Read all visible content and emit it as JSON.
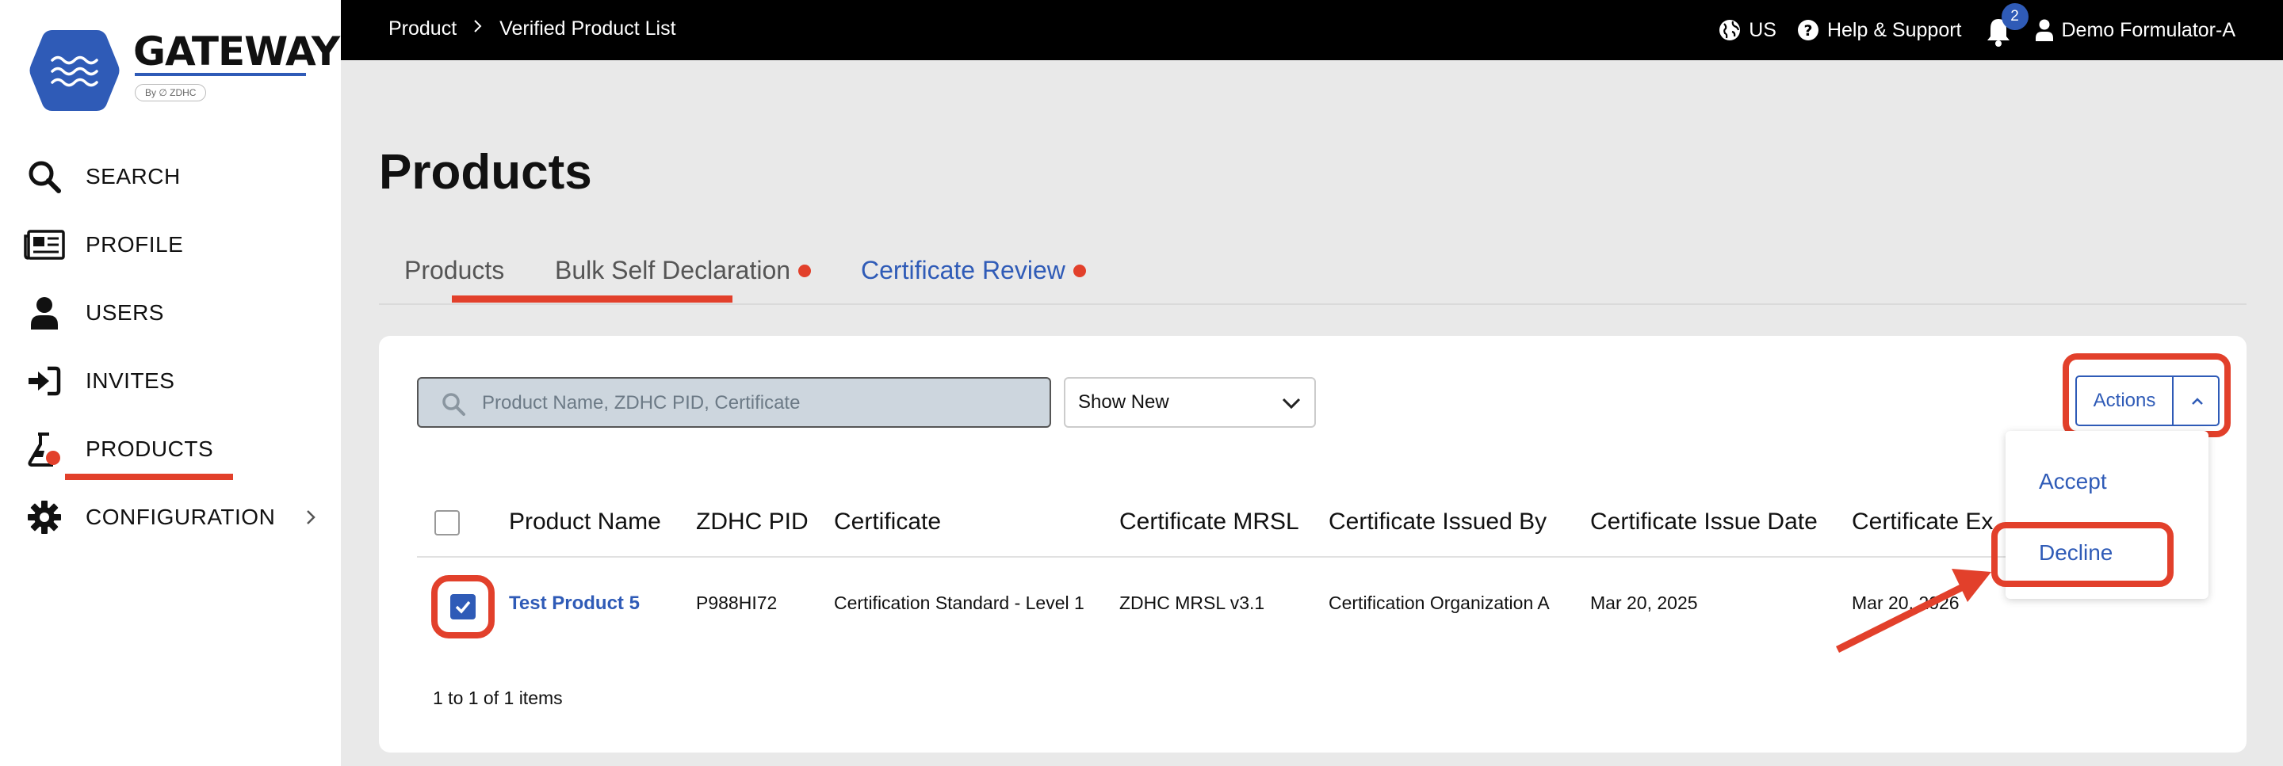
{
  "sidebar": {
    "logo": {
      "title": "GATEWAY",
      "by": "By ∅ ZDHC"
    },
    "items": [
      {
        "label": "SEARCH",
        "icon": "search-icon"
      },
      {
        "label": "PROFILE",
        "icon": "profile-card-icon"
      },
      {
        "label": "USERS",
        "icon": "user-icon"
      },
      {
        "label": "INVITES",
        "icon": "sign-in-icon"
      },
      {
        "label": "PRODUCTS",
        "icon": "flask-icon",
        "active": true
      },
      {
        "label": "CONFIGURATION",
        "icon": "gear-icon"
      }
    ]
  },
  "topbar": {
    "breadcrumb": [
      "Product",
      "Verified Product List"
    ],
    "region": "US",
    "help": "Help & Support",
    "notifications": "2",
    "user": "Demo Formulator-A"
  },
  "page": {
    "title": "Products",
    "tabs": [
      {
        "label": "Products",
        "dot": false
      },
      {
        "label": "Bulk Self Declaration",
        "dot": true
      },
      {
        "label": "Certificate Review",
        "dot": true,
        "active": true
      }
    ]
  },
  "filters": {
    "search_placeholder": "Product Name, ZDHC PID, Certificate",
    "show_value": "Show New"
  },
  "actions": {
    "label": "Actions",
    "menu": [
      "Accept",
      "Decline"
    ]
  },
  "table": {
    "columns": [
      "Product Name",
      "ZDHC PID",
      "Certificate",
      "Certificate MRSL",
      "Certificate Issued By",
      "Certificate Issue Date",
      "Certificate Ex"
    ],
    "rows": [
      {
        "product_name": "Test Product 5",
        "zdhc_pid": "P988HI72",
        "certificate": "Certification Standard - Level 1",
        "certificate_mrsl": "ZDHC MRSL v3.1",
        "issued_by": "Certification Organization A",
        "issue_date": "Mar 20, 2025",
        "expiry": "Mar 20, 2026",
        "checked": true
      }
    ],
    "pager": "1 to 1 of 1 items"
  },
  "colors": {
    "accent": "#2f5bb7",
    "highlight": "#e2402b",
    "topbar": "#000000"
  }
}
